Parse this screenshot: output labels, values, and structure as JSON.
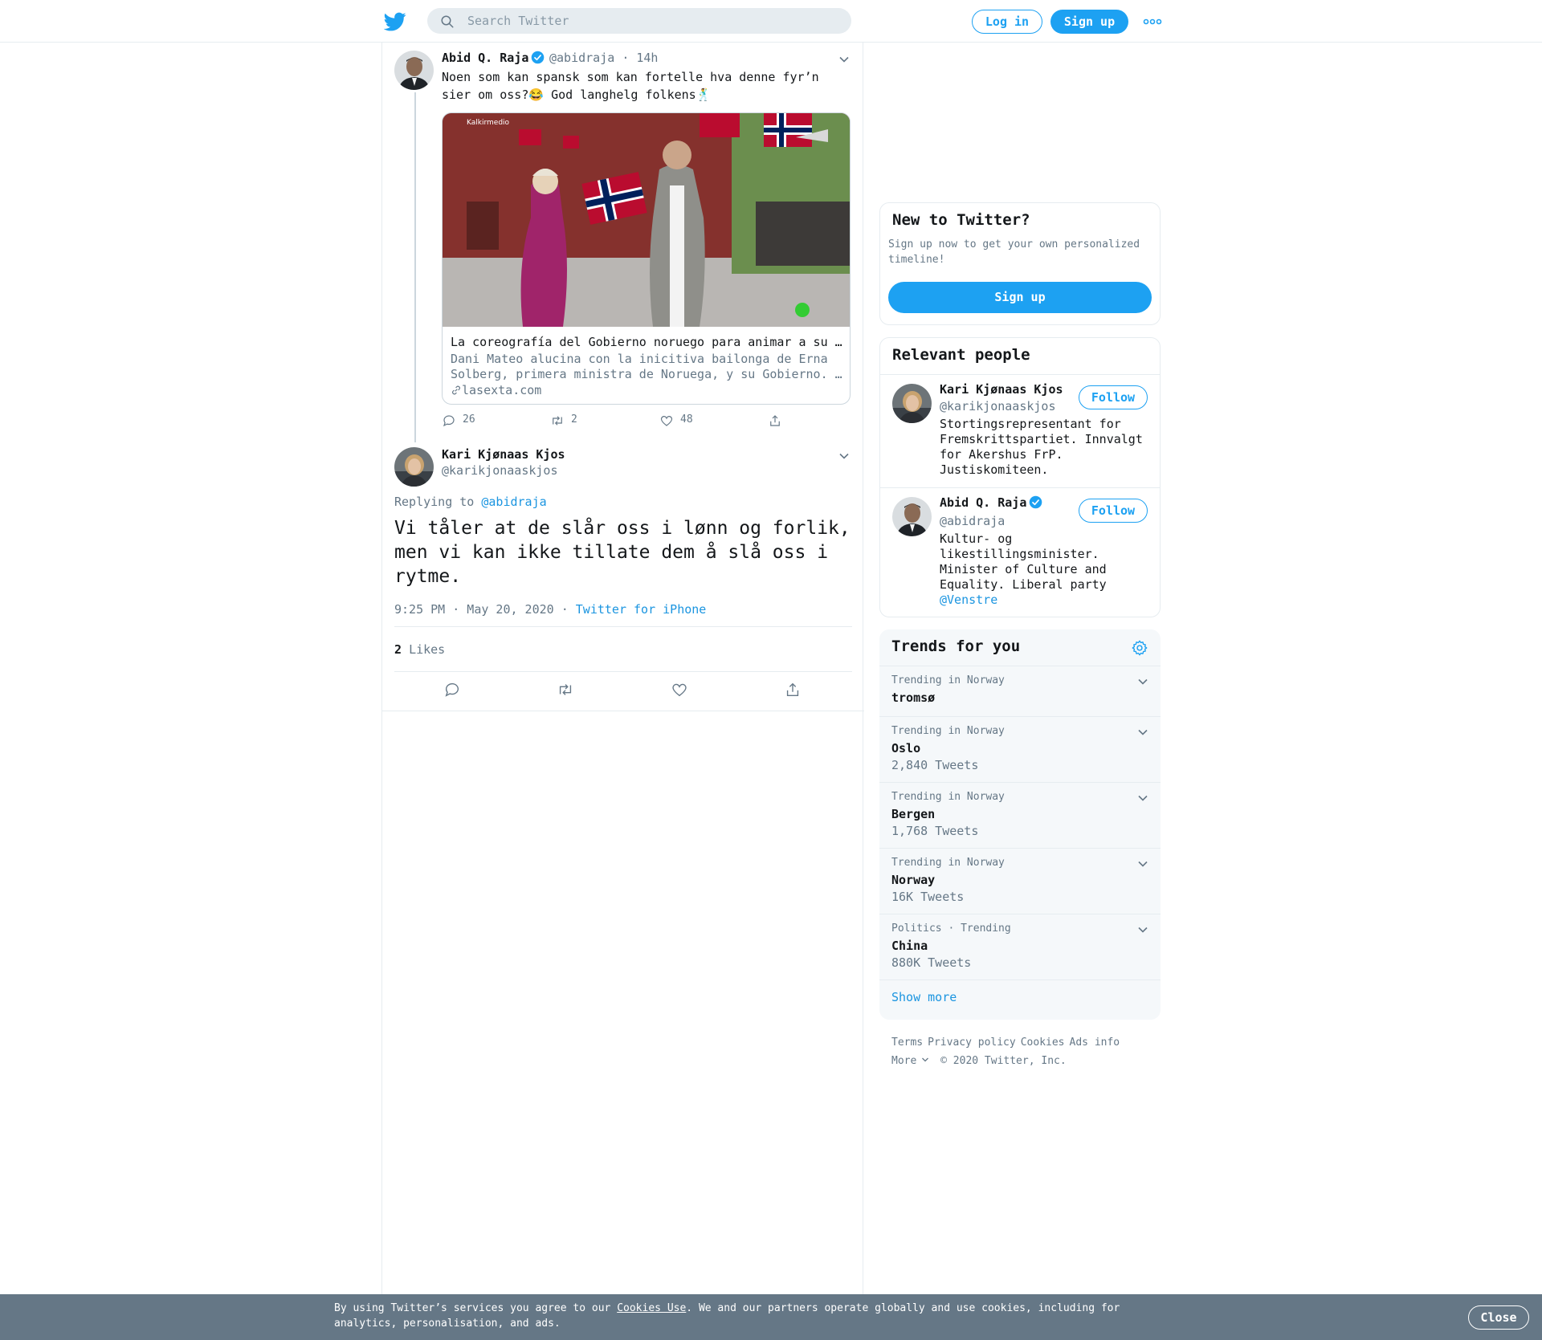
{
  "header": {
    "search_placeholder": "Search Twitter",
    "login_label": "Log in",
    "signup_label": "Sign up"
  },
  "thread": {
    "parent": {
      "author_name": "Abid Q. Raja",
      "handle": "@abidraja",
      "time": "· 14h",
      "text": "Noen som kan spansk som kan fortelle hva denne fyr’n sier om oss?😂 God langhelg folkens🕺",
      "card": {
        "image_watermark": "Kalkirmedio",
        "title": "La coreografía del Gobierno noruego para animar a su …",
        "description": "Dani Mateo alucina con la inicitiva bailonga de Erna Solberg, primera ministra de Noruega, y su Gobierno. …",
        "domain": "lasexta.com"
      },
      "replies": "26",
      "retweets": "2",
      "likes": "48"
    },
    "main": {
      "author_name": "Kari Kjønaas Kjos",
      "handle": "@karikjonaaskjos",
      "replying_prefix": "Replying to",
      "replying_to": "@abidraja",
      "text": "Vi tåler at de slår oss i lønn og forlik, men vi kan ikke tillate dem å slå oss i rytme.",
      "timestamp": "9:25 PM · May 20, 2020",
      "dot": "·",
      "source": "Twitter for iPhone",
      "likes_count": "2",
      "likes_label": "Likes"
    }
  },
  "sidebar": {
    "new_to_twitter": {
      "title": "New to Twitter?",
      "description": "Sign up now to get your own personalized timeline!",
      "button": "Sign up"
    },
    "relevant_people": {
      "title": "Relevant people",
      "people": [
        {
          "name": "Kari Kjønaas Kjos",
          "handle": "@karikjonaaskjos",
          "bio": "Stortingsrepresentant for Fremskrittspartiet. Innvalgt for Akershus FrP. Justiskomiteen.",
          "follow": "Follow"
        },
        {
          "name": "Abid Q. Raja",
          "handle": "@abidraja",
          "bio": "Kultur- og likestillingsminister. Minister of Culture and Equality. Liberal party",
          "bio_link": "@Venstre",
          "follow": "Follow"
        }
      ]
    },
    "trends": {
      "title": "Trends for you",
      "items": [
        {
          "context": "Trending in Norway",
          "name": "tromsø",
          "count": ""
        },
        {
          "context": "Trending in Norway",
          "name": "Oslo",
          "count": "2,840 Tweets"
        },
        {
          "context": "Trending in Norway",
          "name": "Bergen",
          "count": "1,768 Tweets"
        },
        {
          "context": "Trending in Norway",
          "name": "Norway",
          "count": "16K Tweets"
        },
        {
          "context": "Politics · Trending",
          "name": "China",
          "count": "880K Tweets"
        }
      ],
      "show_more": "Show more"
    },
    "footer": {
      "links": [
        "Terms",
        "Privacy policy",
        "Cookies",
        "Ads info"
      ],
      "more": "More",
      "copyright": "© 2020 Twitter, Inc."
    }
  },
  "cookie_banner": {
    "text_before": "By using Twitter’s services you agree to our ",
    "link": "Cookies Use",
    "text_after": ". We and our partners operate globally and use cookies, including for analytics, personalisation, and ads.",
    "close": "Close"
  },
  "colors": {
    "brand_blue": "#1da1f2",
    "link_blue": "#1b95e0",
    "muted": "#657786",
    "border": "#e6ecf0",
    "cookie_bg": "#657786"
  }
}
